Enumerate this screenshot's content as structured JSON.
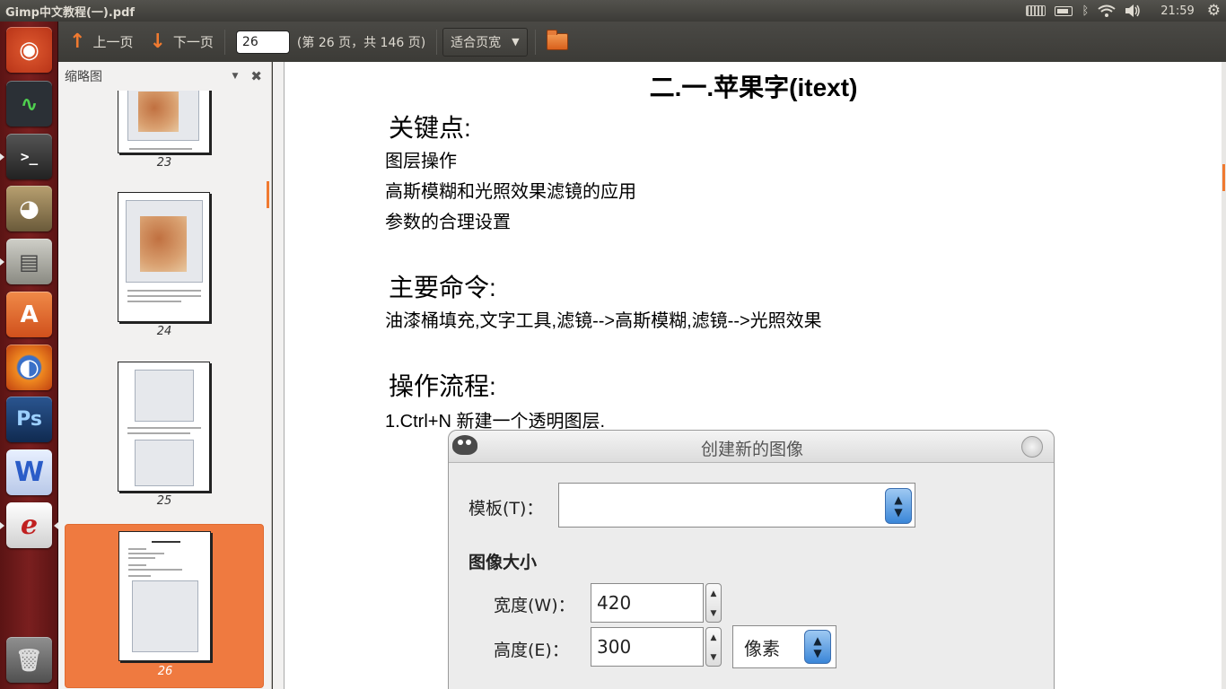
{
  "window": {
    "title": "Gimp中文教程(一).pdf"
  },
  "panel": {
    "time": "21:59"
  },
  "launcher": {
    "items": [
      {
        "name": "ubuntu-dash-icon",
        "glyph": "◉",
        "bg": "#c9401c"
      },
      {
        "name": "system-monitor-icon",
        "glyph": "∿",
        "bg": "#2b3036"
      },
      {
        "name": "terminal-icon",
        "glyph": ">_",
        "bg": "#2a2a2a"
      },
      {
        "name": "gimp-icon",
        "glyph": "◕",
        "bg": "#8a7a58"
      },
      {
        "name": "files-icon",
        "glyph": "▤",
        "bg": "#a8a8a0"
      },
      {
        "name": "software-center-icon",
        "glyph": "A",
        "bg": "#e06a2c"
      },
      {
        "name": "firefox-icon",
        "glyph": "◐",
        "bg": "#e07a20"
      },
      {
        "name": "photoshop-icon",
        "glyph": "Ps",
        "bg": "#1d3f70"
      },
      {
        "name": "wps-writer-icon",
        "glyph": "W",
        "bg": "#2a66c8"
      },
      {
        "name": "pdf-viewer-icon",
        "glyph": "ℯ",
        "bg": "#d8d8d8"
      }
    ],
    "trash": {
      "glyph": "🗑"
    }
  },
  "toolbar": {
    "prev_label": "上一页",
    "next_label": "下一页",
    "page_value": "26",
    "page_info": "(第 26 页，共 146 页)",
    "zoom_label": "适合页宽"
  },
  "sidebar": {
    "title": "缩略图",
    "thumbs": [
      {
        "num": "23",
        "selected": false
      },
      {
        "num": "24",
        "selected": false
      },
      {
        "num": "25",
        "selected": false
      },
      {
        "num": "26",
        "selected": true
      }
    ]
  },
  "document": {
    "title": "二.一.苹果字(itext)",
    "section1_heading": "关键点:",
    "section1_items": [
      "图层操作",
      "高斯模糊和光照效果滤镜的应用",
      "参数的合理设置"
    ],
    "section2_heading": "主要命令:",
    "section2_text": "油漆桶填充,文字工具,滤镜-->高斯模糊,滤镜-->光照效果",
    "section3_heading": "操作流程:",
    "section3_step1": "1.Ctrl+N 新建一个透明图层.",
    "dialog": {
      "title": "创建新的图像",
      "template_label": "模板(T)：",
      "image_size_label": "图像大小",
      "width_label": "宽度(W)：",
      "width_value": "420",
      "height_label": "高度(E)：",
      "height_value": "300",
      "unit_value": "像素"
    }
  }
}
